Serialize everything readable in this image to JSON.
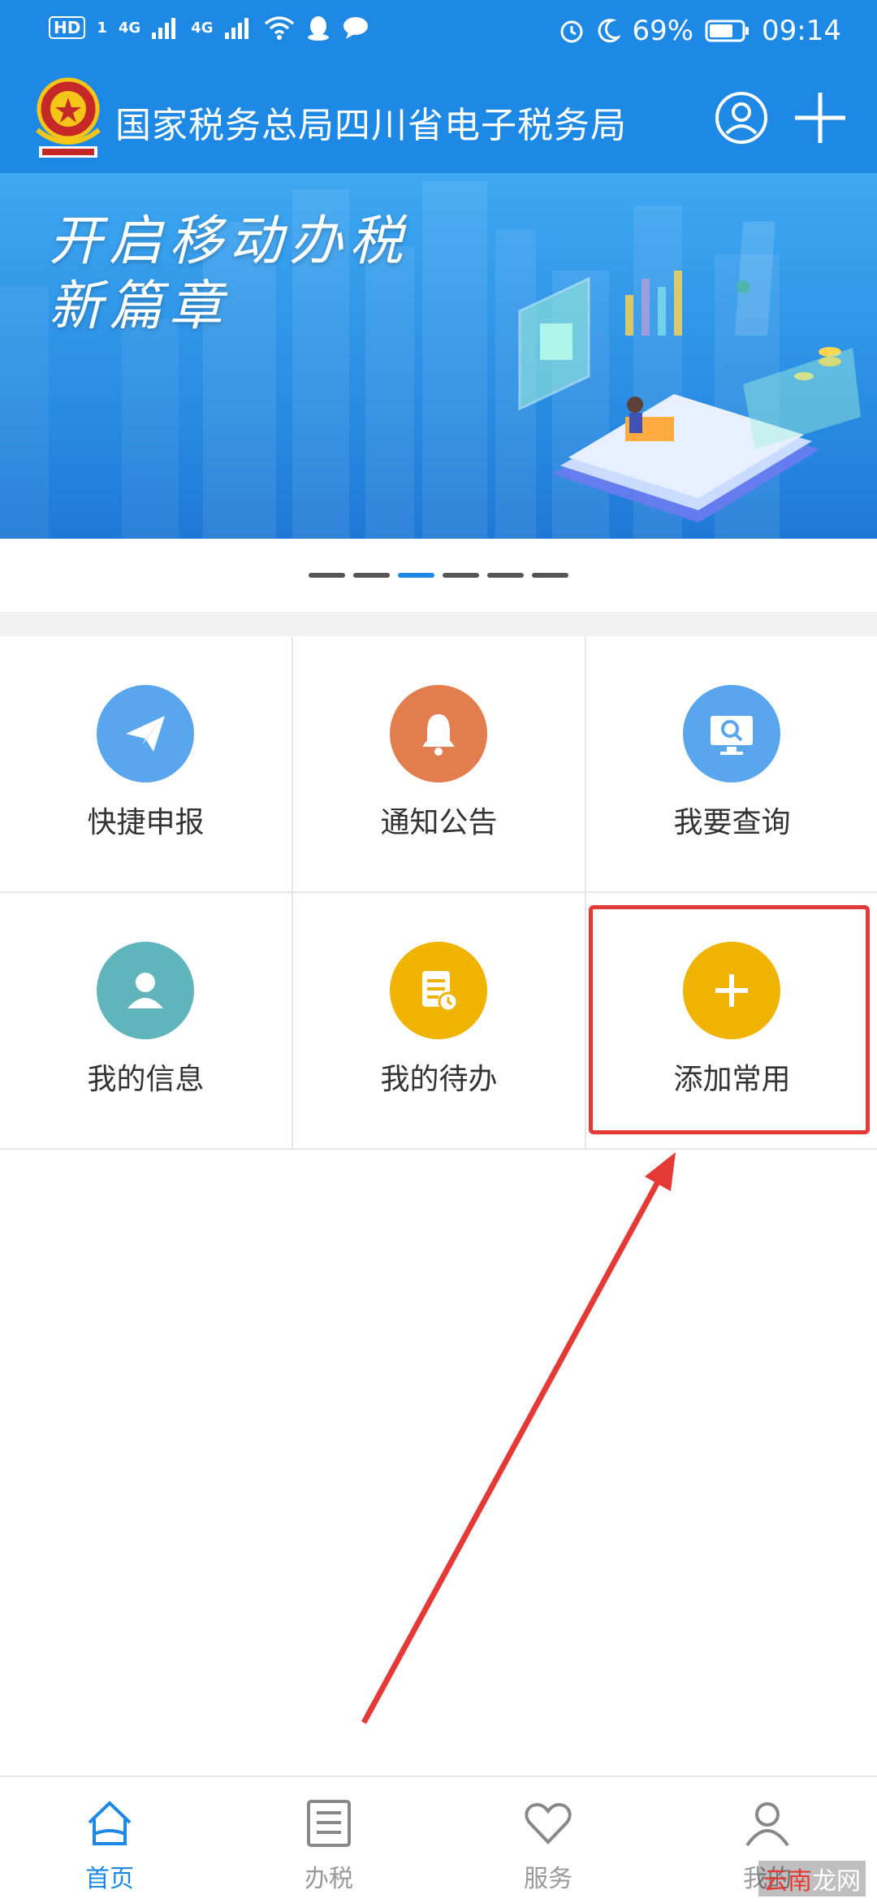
{
  "status_bar": {
    "hd": "HD",
    "sim1": "1",
    "net1": "4G",
    "net2": "4G",
    "battery": "69%",
    "time": "09:14"
  },
  "header": {
    "title": "国家税务总局四川省电子税务局",
    "icons": [
      "emblem-icon",
      "user-icon",
      "plus-icon"
    ]
  },
  "banner": {
    "slogan_line1": "开启移动办税",
    "slogan_line2": "新篇章"
  },
  "carousel": {
    "total": 6,
    "active_index": 3
  },
  "grid": {
    "items": [
      {
        "label": "快捷申报",
        "icon": "paper-plane-icon",
        "color": "#5aa6ee"
      },
      {
        "label": "通知公告",
        "icon": "bell-icon",
        "color": "#e27e4e"
      },
      {
        "label": "我要查询",
        "icon": "search-monitor-icon",
        "color": "#5aa6ee"
      },
      {
        "label": "我的信息",
        "icon": "person-icon",
        "color": "#5fb5bb"
      },
      {
        "label": "我的待办",
        "icon": "document-clock-icon",
        "color": "#efb300"
      },
      {
        "label": "添加常用",
        "icon": "plus-icon",
        "color": "#efb300"
      }
    ]
  },
  "colors": {
    "primary": "#1e88e5",
    "annotation": "#e53935"
  },
  "tabbar": {
    "items": [
      {
        "label": "首页",
        "icon": "home-icon",
        "active": true
      },
      {
        "label": "办税",
        "icon": "list-icon",
        "active": false
      },
      {
        "label": "服务",
        "icon": "heart-icon",
        "active": false
      },
      {
        "label": "我的",
        "icon": "user-icon",
        "active": false
      }
    ]
  },
  "watermark": {
    "part1": "云南",
    "part2": "龙网"
  }
}
